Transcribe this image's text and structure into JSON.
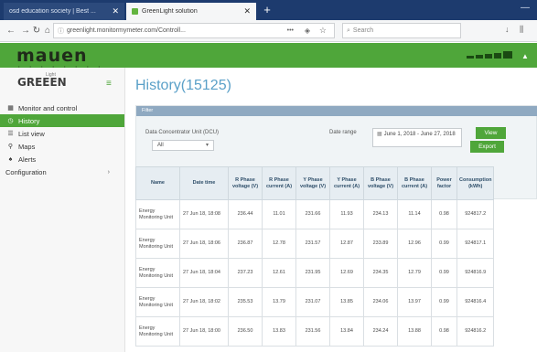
{
  "browser": {
    "tabs": [
      {
        "label": "osd education society | Best ...",
        "active": false
      },
      {
        "label": "GreenLight solution",
        "active": true
      }
    ],
    "address": "greenlight.monitormymeter.com/Controll...",
    "search_placeholder": "Search"
  },
  "header": {
    "logo_text": "mauen",
    "logo_dots": "• • • • • • • •"
  },
  "sidebar": {
    "brand": "GREEEN",
    "brand_sub": "Light",
    "items": [
      {
        "label": "Monitor and control",
        "icon": "grid-icon",
        "active": false
      },
      {
        "label": "History",
        "icon": "clock-icon",
        "active": true
      },
      {
        "label": "List view",
        "icon": "list-icon",
        "active": false
      },
      {
        "label": "Maps",
        "icon": "map-pin-icon",
        "active": false
      },
      {
        "label": "Alerts",
        "icon": "bell-icon",
        "active": false
      },
      {
        "label": "Configuration",
        "icon": "",
        "active": false,
        "has_submenu": true
      }
    ]
  },
  "main": {
    "title": "History(15125)",
    "filter": {
      "heading": "Filter",
      "dcu_label": "Data Concentrator Unit (DCU)",
      "dcu_value": "All",
      "date_label": "Date range",
      "date_value": "June 1, 2018 - June 27, 2018",
      "view_label": "View",
      "export_label": "Export"
    },
    "table": {
      "headers": [
        "Name",
        "Date time",
        "R Phase voltage (V)",
        "R Phase current (A)",
        "Y Phase voltage (V)",
        "Y Phase current (A)",
        "B Phase voltage (V)",
        "B Phase current (A)",
        "Power factor",
        "Consumption (kWh)"
      ],
      "rows": [
        [
          "Energy Monitoring Unit",
          "27 Jun 18, 18:08",
          "236.44",
          "11.01",
          "231.66",
          "11.93",
          "234.13",
          "11.14",
          "0.98",
          "924817.2"
        ],
        [
          "Energy Monitoring Unit",
          "27 Jun 18, 18:06",
          "236.87",
          "12.78",
          "231.57",
          "12.87",
          "233.89",
          "12.96",
          "0.99",
          "924817.1"
        ],
        [
          "Energy Monitoring Unit",
          "27 Jun 18, 18:04",
          "237.23",
          "12.61",
          "231.95",
          "12.69",
          "234.35",
          "12.79",
          "0.99",
          "924816.9"
        ],
        [
          "Energy Monitoring Unit",
          "27 Jun 18, 18:02",
          "235.53",
          "13.79",
          "231.07",
          "13.85",
          "234.06",
          "13.97",
          "0.99",
          "924816.4"
        ],
        [
          "Energy Monitoring Unit",
          "27 Jun 18, 18:00",
          "236.50",
          "13.83",
          "231.56",
          "13.84",
          "234.24",
          "13.88",
          "0.98",
          "924816.2"
        ]
      ]
    }
  },
  "colors": {
    "brand_green": "#4fa63a",
    "title_blue": "#5aa0c8",
    "tab_strip": "#1d3b6e"
  }
}
